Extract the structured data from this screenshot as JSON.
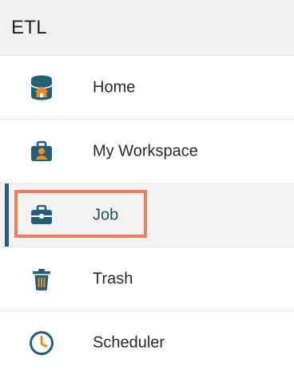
{
  "header": {
    "title": "ETL"
  },
  "menu": {
    "items": [
      {
        "label": "Home",
        "icon": "home-database-icon"
      },
      {
        "label": "My Workspace",
        "icon": "workspace-briefcase-icon"
      },
      {
        "label": "Job",
        "icon": "job-briefcase-icon",
        "active": true
      },
      {
        "label": "Trash",
        "icon": "trash-icon"
      },
      {
        "label": "Scheduler",
        "icon": "clock-icon"
      }
    ]
  },
  "colors": {
    "header_bg": "#f1f1f1",
    "icon_dark": "#1f5f7a",
    "icon_orange": "#f08a24",
    "active_bar": "#1f5f7a",
    "highlight": "#f07f5f"
  }
}
